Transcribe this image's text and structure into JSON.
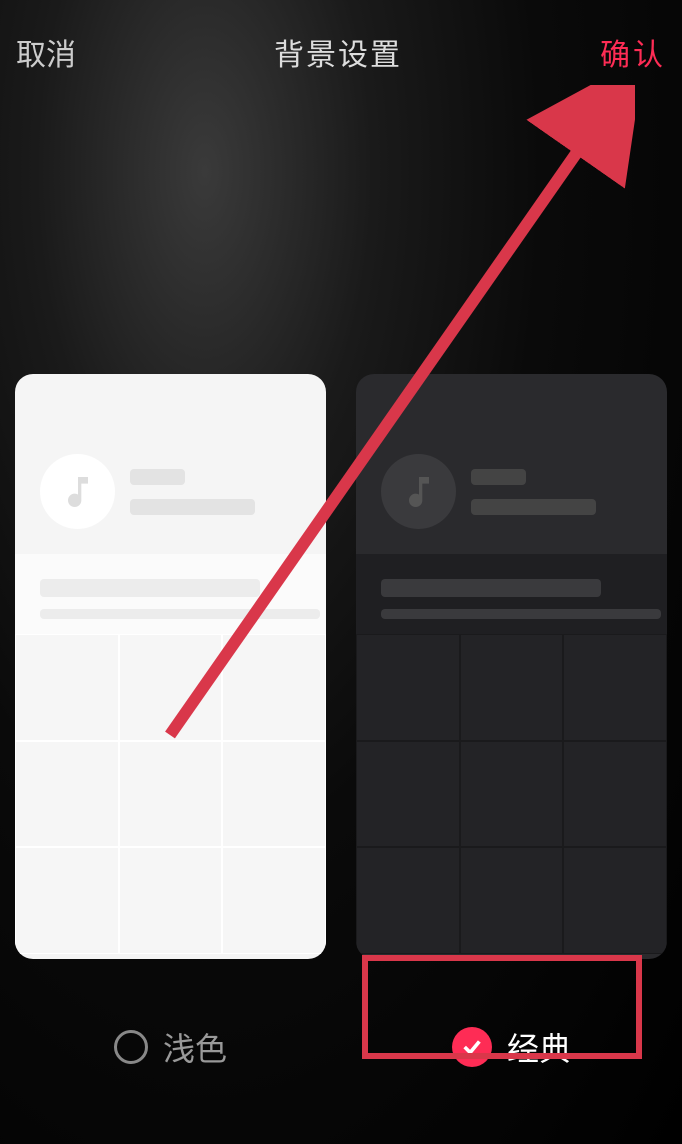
{
  "header": {
    "cancel": "取消",
    "title": "背景设置",
    "confirm": "确认"
  },
  "themes": {
    "light_label": "浅色",
    "dark_label": "经典"
  }
}
